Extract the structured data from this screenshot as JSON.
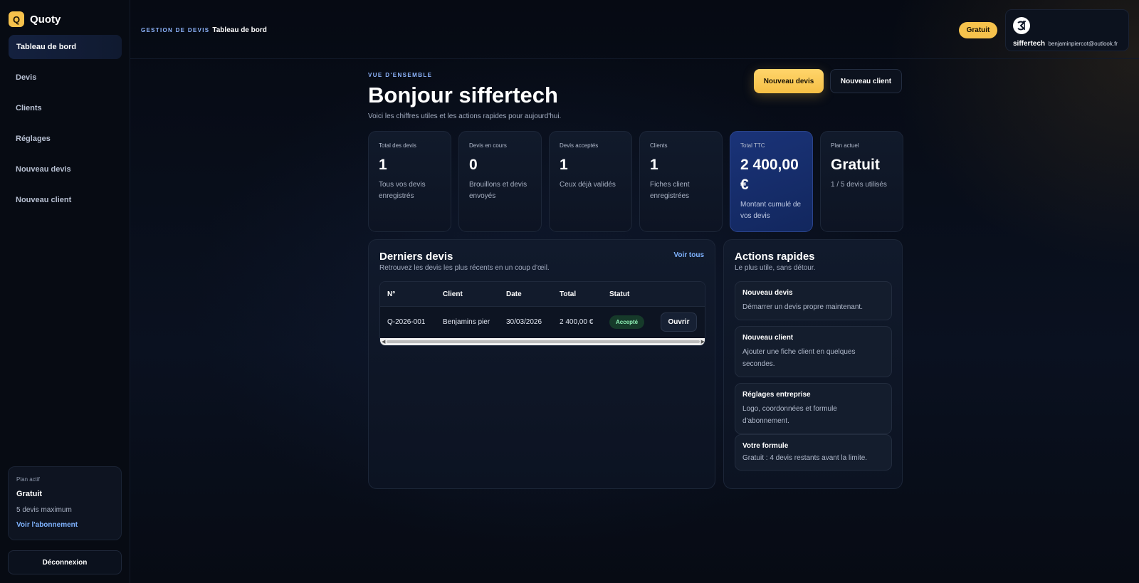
{
  "brand": {
    "logo_letter": "Q",
    "name": "Quoty",
    "accent": "#f6c24c"
  },
  "sidebar": {
    "items": [
      {
        "label": "Tableau de bord",
        "active": true
      },
      {
        "label": "Devis"
      },
      {
        "label": "Clients"
      },
      {
        "label": "Réglages"
      },
      {
        "label": "Nouveau devis"
      },
      {
        "label": "Nouveau client"
      }
    ],
    "plan": {
      "label": "Plan actif",
      "name": "Gratuit",
      "limit": "5 devis maximum",
      "link": "Voir l'abonnement"
    },
    "logout": "Déconnexion"
  },
  "header": {
    "section": "GESTION DE DEVIS",
    "page": "Tableau de bord",
    "plan_pill": "Gratuit",
    "user": {
      "avatar_icon": "company-logo-icon",
      "name": "siffertech",
      "email": "benjaminpiercot@outlook.fr"
    }
  },
  "main": {
    "eyebrow": "VUE D'ENSEMBLE",
    "greeting": "Bonjour siffertech",
    "subtitle": "Voici les chiffres utiles et les actions rapides pour aujourd'hui.",
    "primary_button": "Nouveau devis",
    "secondary_button": "Nouveau client",
    "stats": [
      {
        "label": "Total des devis",
        "value": "1",
        "desc": "Tous vos devis enregistrés"
      },
      {
        "label": "Devis en cours",
        "value": "0",
        "desc": "Brouillons et devis envoyés"
      },
      {
        "label": "Devis acceptés",
        "value": "1",
        "desc": "Ceux déjà validés"
      },
      {
        "label": "Clients",
        "value": "1",
        "desc": "Fiches client enregistrées"
      },
      {
        "label": "Total TTC",
        "value": "2 400,00 €",
        "desc": "Montant cumulé de vos devis",
        "highlight": true
      },
      {
        "label": "Plan actuel",
        "value": "Gratuit",
        "desc": "1 / 5 devis utilisés"
      }
    ],
    "recent": {
      "title": "Derniers devis",
      "subtitle": "Retrouvez les devis les plus récents en un coup d'œil.",
      "see_all": "Voir tous",
      "columns": [
        "N°",
        "Client",
        "Date",
        "Total",
        "Statut"
      ],
      "rows": [
        {
          "number": "Q-2026-001",
          "client": "Benjamins pier",
          "date": "30/03/2026",
          "total": "2 400,00 €",
          "status": "Accepté",
          "action": "Ouvrir"
        }
      ]
    },
    "quick_actions": {
      "title": "Actions rapides",
      "subtitle": "Le plus utile, sans détour.",
      "items": [
        {
          "title": "Nouveau devis",
          "desc": "Démarrer un devis propre maintenant."
        },
        {
          "title": "Nouveau client",
          "desc": "Ajouter une fiche client en quelques secondes."
        },
        {
          "title": "Réglages entreprise",
          "desc": "Logo, coordonnées et formule d'abonnement."
        },
        {
          "title": "Votre formule",
          "desc": "Gratuit : 4 devis restants avant la limite."
        }
      ]
    }
  }
}
